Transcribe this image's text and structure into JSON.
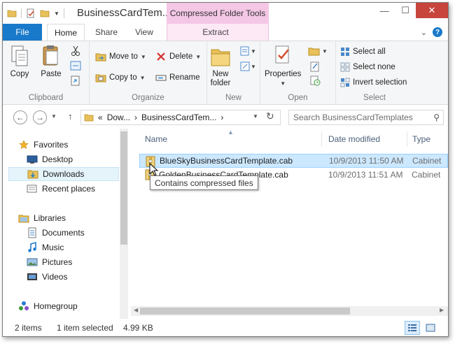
{
  "window": {
    "title": "BusinessCardTem...",
    "context_tab_header": "Compressed Folder Tools",
    "controls": {
      "minimize": "—",
      "maximize": "☐",
      "close": "✕"
    }
  },
  "tabs": {
    "file": "File",
    "home": "Home",
    "share": "Share",
    "view": "View",
    "extract": "Extract"
  },
  "ribbon": {
    "clipboard": {
      "label": "Clipboard",
      "copy": "Copy",
      "paste": "Paste"
    },
    "organize": {
      "label": "Organize",
      "move_to": "Move to",
      "copy_to": "Copy to",
      "delete": "Delete",
      "rename": "Rename"
    },
    "new": {
      "label": "New",
      "new_folder_line1": "New",
      "new_folder_line2": "folder"
    },
    "open": {
      "label": "Open",
      "properties": "Properties"
    },
    "select": {
      "label": "Select",
      "select_all": "Select all",
      "select_none": "Select none",
      "invert_selection": "Invert selection"
    }
  },
  "address": {
    "prefix": "«",
    "crumb1": "Dow...",
    "crumb2": "BusinessCardTem...",
    "search_placeholder": "Search BusinessCardTemplates"
  },
  "nav": {
    "favorites": "Favorites",
    "desktop": "Desktop",
    "downloads": "Downloads",
    "recent": "Recent places",
    "libraries": "Libraries",
    "documents": "Documents",
    "music": "Music",
    "pictures": "Pictures",
    "videos": "Videos",
    "homegroup": "Homegroup"
  },
  "columns": {
    "name": "Name",
    "date": "Date modified",
    "type": "Type"
  },
  "files": [
    {
      "name": "BlueSkyBusinessCardTemplate.cab",
      "date": "10/9/2013 11:50 AM",
      "type": "Cabinet",
      "selected": true
    },
    {
      "name": "GoldenBusinessCardTemplate.cab",
      "date": "10/9/2013 11:51 AM",
      "type": "Cabinet",
      "selected": false
    }
  ],
  "tooltip": "Contains compressed files",
  "status": {
    "items": "2 items",
    "selected": "1 item selected",
    "size": "4.99 KB"
  }
}
